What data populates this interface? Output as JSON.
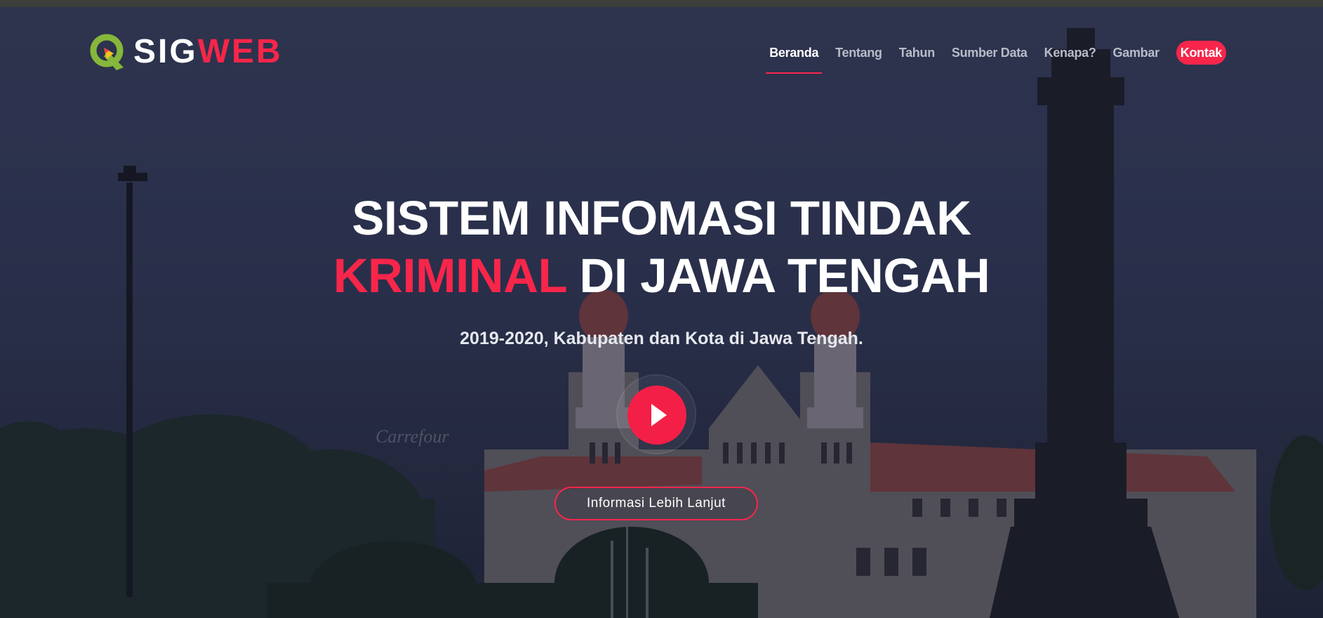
{
  "brand": {
    "part1": "SIG",
    "part2": "WEB",
    "accent_color": "#f7264a"
  },
  "nav": {
    "items": [
      {
        "label": "Beranda",
        "active": true
      },
      {
        "label": "Tentang"
      },
      {
        "label": "Tahun"
      },
      {
        "label": "Sumber Data"
      },
      {
        "label": "Kenapa?"
      },
      {
        "label": "Gambar"
      }
    ],
    "cta": "Kontak"
  },
  "hero": {
    "title_line1": "SISTEM INFOMASI TINDAK",
    "title_accent": "KRIMINAL",
    "title_rest": " DI JAWA TENGAH",
    "subtitle": "2019-2020, Kabupaten dan Kota di Jawa Tengah.",
    "play_icon": "play-icon",
    "button_label": "Informasi Lebih Lanjut"
  },
  "background_scene": {
    "sign_text": "Carrefour"
  }
}
